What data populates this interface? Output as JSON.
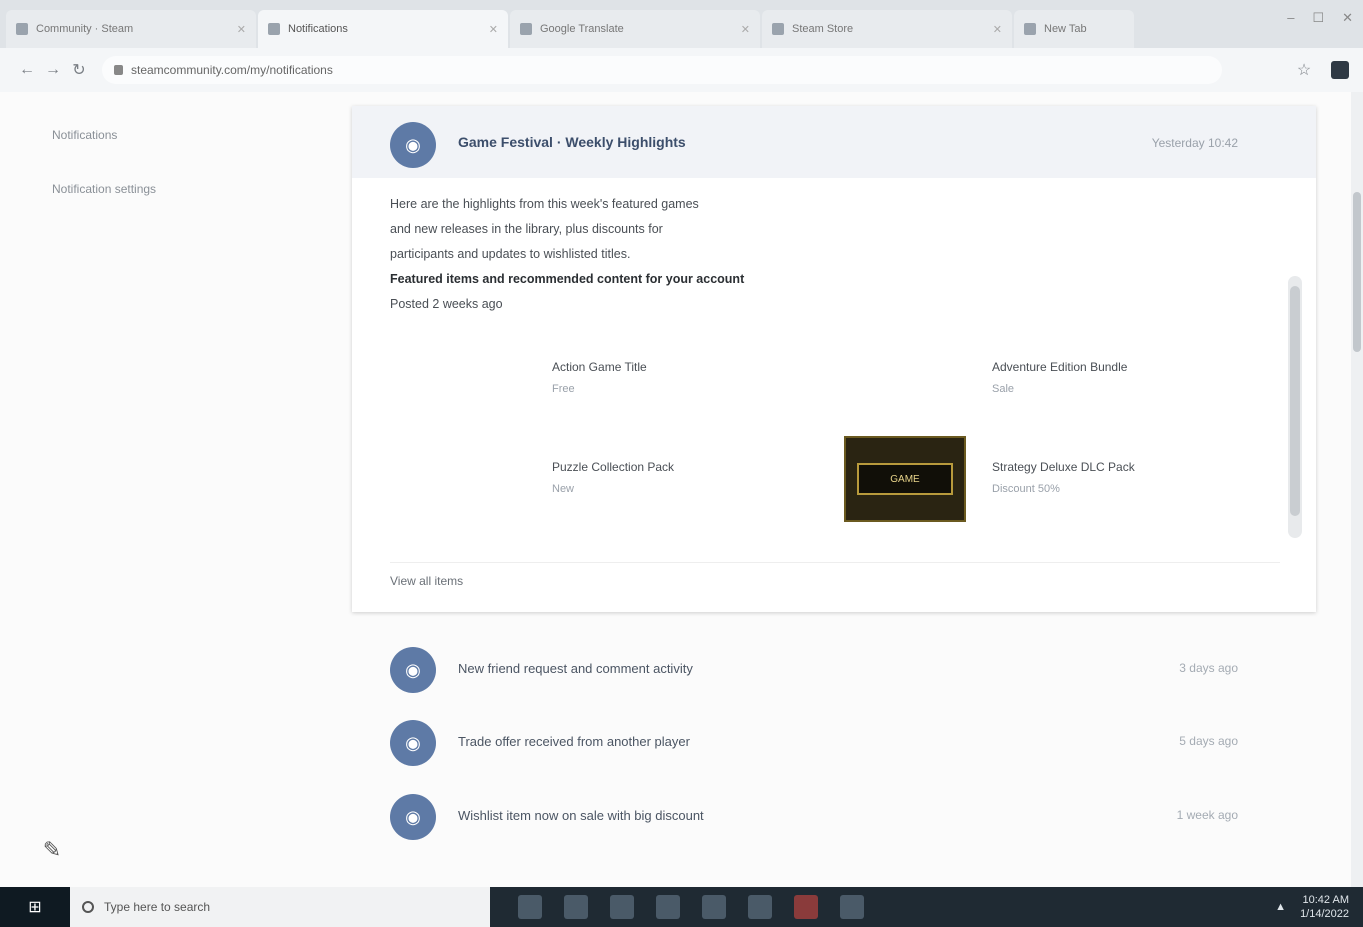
{
  "browser": {
    "tabs": [
      {
        "label": "Community · Steam",
        "active": false
      },
      {
        "label": "Notifications",
        "active": true
      },
      {
        "label": "Google Translate",
        "active": false
      },
      {
        "label": "Steam Store",
        "active": false
      },
      {
        "label": "New Tab",
        "active": false
      }
    ],
    "address": "steamcommunity.com/my/notifications",
    "window_controls": [
      "–",
      "☐",
      "✕"
    ]
  },
  "sidebar": {
    "links": [
      "Notifications",
      "Notification settings"
    ],
    "compose_icon": "pencil-icon"
  },
  "expanded": {
    "title": "Game Festival · Weekly Highlights",
    "time": "Yesterday 10:42",
    "body_lines": [
      "Here are the highlights from this week's featured games",
      "and new releases in the library, plus discounts for",
      "participants and updates to wishlisted titles.",
      "Featured items and recommended content for your account",
      "Posted 2 weeks ago"
    ],
    "cells": [
      {
        "title": "Action Game Title",
        "sub": "Free"
      },
      {
        "title": "Adventure Edition Bundle",
        "sub": "Sale"
      },
      {
        "title": "Puzzle Collection Pack",
        "sub": "New"
      },
      {
        "title": "Strategy Deluxe DLC Pack",
        "sub": "Discount 50%"
      }
    ],
    "thumb_label": "GAME",
    "footer": "View all items"
  },
  "notifications": [
    {
      "title": "New friend request and comment activity",
      "time": "3 days ago"
    },
    {
      "title": "Trade offer received from another player",
      "time": "5 days ago"
    },
    {
      "title": "Wishlist item now on sale with big discount",
      "time": "1 week ago"
    }
  ],
  "taskbar": {
    "search_placeholder": "Type here to search",
    "time": "10:42 AM",
    "date": "1/14/2022"
  }
}
